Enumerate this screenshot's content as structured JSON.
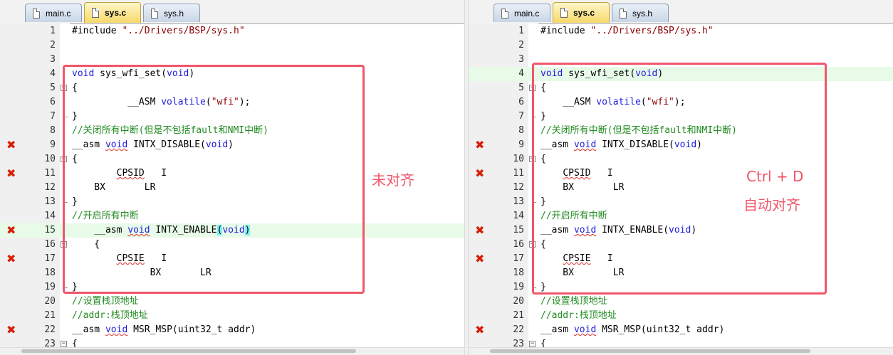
{
  "tabs": [
    {
      "label": "main.c",
      "active": false
    },
    {
      "label": "sys.c",
      "active": true
    },
    {
      "label": "sys.h",
      "active": false
    }
  ],
  "panes": [
    {
      "annotation": [
        "未对齐"
      ],
      "lines": [
        {
          "n": "1",
          "segs": [
            [
              "#include ",
              "t"
            ],
            [
              "\"../Drivers/BSP/sys.h\"",
              "str"
            ]
          ]
        },
        {
          "n": "2",
          "segs": []
        },
        {
          "n": "3",
          "segs": []
        },
        {
          "n": "4",
          "segs": [
            [
              "void",
              "kw"
            ],
            [
              " sys_wfi_set(",
              "t"
            ],
            [
              "void",
              "kw"
            ],
            [
              ")",
              "t"
            ]
          ]
        },
        {
          "n": "5",
          "fold": "open",
          "segs": [
            [
              "{",
              "t"
            ]
          ]
        },
        {
          "n": "6",
          "fold": "bar",
          "segs": [
            [
              "          __ASM ",
              "t"
            ],
            [
              "volatile",
              "kw"
            ],
            [
              "(",
              "t"
            ],
            [
              "\"wfi\"",
              "str"
            ],
            [
              ");",
              "t"
            ]
          ]
        },
        {
          "n": "7",
          "fold": "end",
          "segs": [
            [
              "}",
              "t"
            ]
          ]
        },
        {
          "n": "8",
          "segs": [
            [
              "//关闭所有中断(但是不包括fault和NMI中断)",
              "cm"
            ]
          ]
        },
        {
          "n": "9",
          "error": true,
          "segs": [
            [
              "__asm ",
              "t"
            ],
            [
              "void",
              "kw sq"
            ],
            [
              " INTX_DISABLE(",
              "t"
            ],
            [
              "void",
              "kw"
            ],
            [
              ")",
              "t"
            ]
          ]
        },
        {
          "n": "10",
          "fold": "open",
          "segs": [
            [
              "{",
              "t"
            ]
          ]
        },
        {
          "n": "11",
          "fold": "bar",
          "error": true,
          "segs": [
            [
              "        ",
              "t"
            ],
            [
              "CPSID",
              "t sq"
            ],
            [
              "   I",
              "t"
            ]
          ]
        },
        {
          "n": "12",
          "fold": "bar",
          "segs": [
            [
              "    BX       LR",
              "t"
            ]
          ]
        },
        {
          "n": "13",
          "fold": "end",
          "segs": [
            [
              "}",
              "t"
            ]
          ]
        },
        {
          "n": "14",
          "segs": [
            [
              "//开启所有中断",
              "cm"
            ]
          ]
        },
        {
          "n": "15",
          "error": true,
          "hl": true,
          "segs": [
            [
              "    __asm ",
              "t"
            ],
            [
              "void",
              "kw sq"
            ],
            [
              " INTX_ENABLE",
              "t"
            ],
            [
              "(",
              "t bm"
            ],
            [
              "void",
              "kw"
            ],
            [
              ")",
              "t bm"
            ]
          ]
        },
        {
          "n": "16",
          "fold": "open",
          "segs": [
            [
              "    {",
              "t"
            ]
          ]
        },
        {
          "n": "17",
          "fold": "bar",
          "error": true,
          "segs": [
            [
              "        ",
              "t"
            ],
            [
              "CPSIE",
              "t sq"
            ],
            [
              "   I",
              "t"
            ]
          ]
        },
        {
          "n": "18",
          "fold": "bar",
          "segs": [
            [
              "              BX       LR",
              "t"
            ]
          ]
        },
        {
          "n": "19",
          "fold": "end",
          "segs": [
            [
              "}",
              "t"
            ]
          ]
        },
        {
          "n": "20",
          "segs": [
            [
              "//设置栈顶地址",
              "cm"
            ]
          ]
        },
        {
          "n": "21",
          "segs": [
            [
              "//addr:栈顶地址",
              "cm"
            ]
          ]
        },
        {
          "n": "22",
          "error": true,
          "segs": [
            [
              "__asm ",
              "t"
            ],
            [
              "void",
              "kw sq"
            ],
            [
              " MSR_MSP(uint32_t addr)",
              "t"
            ]
          ]
        },
        {
          "n": "23",
          "fold": "open",
          "segs": [
            [
              "{",
              "t"
            ]
          ]
        }
      ]
    },
    {
      "annotation": [
        "Ctrl + D",
        "自动对齐"
      ],
      "lines": [
        {
          "n": "1",
          "segs": [
            [
              "#include ",
              "t"
            ],
            [
              "\"../Drivers/BSP/sys.h\"",
              "str"
            ]
          ]
        },
        {
          "n": "2",
          "segs": []
        },
        {
          "n": "3",
          "segs": []
        },
        {
          "n": "4",
          "hl": true,
          "segs": [
            [
              "void",
              "kw"
            ],
            [
              " sys_wfi_set(",
              "t"
            ],
            [
              "void",
              "kw"
            ],
            [
              ")",
              "t"
            ]
          ]
        },
        {
          "n": "5",
          "fold": "open",
          "segs": [
            [
              "{",
              "t"
            ]
          ]
        },
        {
          "n": "6",
          "fold": "bar",
          "segs": [
            [
              "    __ASM ",
              "t"
            ],
            [
              "volatile",
              "kw"
            ],
            [
              "(",
              "t"
            ],
            [
              "\"wfi\"",
              "str"
            ],
            [
              ");",
              "t"
            ]
          ]
        },
        {
          "n": "7",
          "fold": "end",
          "segs": [
            [
              "}",
              "t"
            ]
          ]
        },
        {
          "n": "8",
          "segs": [
            [
              "//关闭所有中断(但是不包括fault和NMI中断)",
              "cm"
            ]
          ]
        },
        {
          "n": "9",
          "error": true,
          "segs": [
            [
              "__asm ",
              "t"
            ],
            [
              "void",
              "kw sq"
            ],
            [
              " INTX_DISABLE(",
              "t"
            ],
            [
              "void",
              "kw"
            ],
            [
              ")",
              "t"
            ]
          ]
        },
        {
          "n": "10",
          "fold": "open",
          "segs": [
            [
              "{",
              "t"
            ]
          ]
        },
        {
          "n": "11",
          "fold": "bar",
          "error": true,
          "segs": [
            [
              "    ",
              "t"
            ],
            [
              "CPSID",
              "t sq"
            ],
            [
              "   I",
              "t"
            ]
          ]
        },
        {
          "n": "12",
          "fold": "bar",
          "segs": [
            [
              "    BX       LR",
              "t"
            ]
          ]
        },
        {
          "n": "13",
          "fold": "end",
          "segs": [
            [
              "}",
              "t"
            ]
          ]
        },
        {
          "n": "14",
          "segs": [
            [
              "//开启所有中断",
              "cm"
            ]
          ]
        },
        {
          "n": "15",
          "error": true,
          "segs": [
            [
              "__asm ",
              "t"
            ],
            [
              "void",
              "kw sq"
            ],
            [
              " INTX_ENABLE(",
              "t"
            ],
            [
              "void",
              "kw"
            ],
            [
              ")",
              "t"
            ]
          ]
        },
        {
          "n": "16",
          "fold": "open",
          "segs": [
            [
              "{",
              "t"
            ]
          ]
        },
        {
          "n": "17",
          "fold": "bar",
          "error": true,
          "segs": [
            [
              "    ",
              "t"
            ],
            [
              "CPSIE",
              "t sq"
            ],
            [
              "   I",
              "t"
            ]
          ]
        },
        {
          "n": "18",
          "fold": "bar",
          "segs": [
            [
              "    BX       LR",
              "t"
            ]
          ]
        },
        {
          "n": "19",
          "fold": "end",
          "segs": [
            [
              "}",
              "t"
            ]
          ]
        },
        {
          "n": "20",
          "segs": [
            [
              "//设置栈顶地址",
              "cm"
            ]
          ]
        },
        {
          "n": "21",
          "segs": [
            [
              "//addr:栈顶地址",
              "cm"
            ]
          ]
        },
        {
          "n": "22",
          "error": true,
          "segs": [
            [
              "__asm ",
              "t"
            ],
            [
              "void",
              "kw sq"
            ],
            [
              " MSR_MSP(uint32_t addr)",
              "t"
            ]
          ]
        },
        {
          "n": "23",
          "fold": "open",
          "segs": [
            [
              "{",
              "t"
            ]
          ]
        }
      ]
    }
  ],
  "icons": {
    "error": "error-cross-icon",
    "fold": "fold-minus-icon",
    "tab_file": "file-icon"
  },
  "colors": {
    "keyword": "#1c1ce0",
    "string": "#8b0000",
    "comment": "#228b22",
    "error": "#d81e06",
    "annotation": "#f0566a",
    "line_highlight": "#e8fbe8",
    "brace_match": "#7df0f7"
  }
}
